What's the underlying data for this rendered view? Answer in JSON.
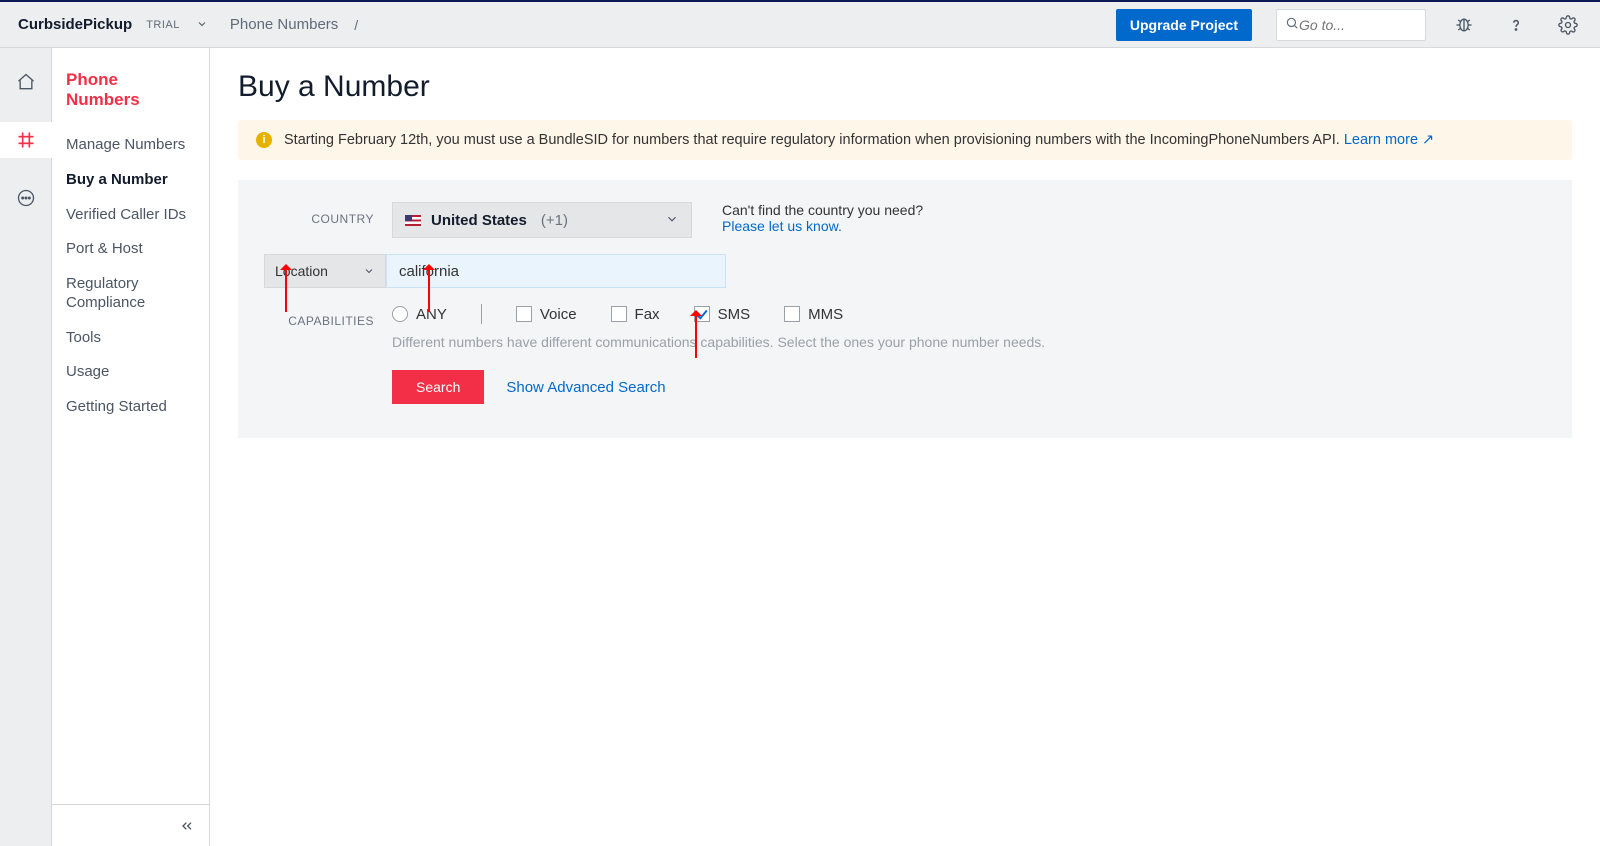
{
  "topbar": {
    "project_name": "CurbsidePickup",
    "trial_label": "TRIAL",
    "breadcrumb": "Phone Numbers",
    "upgrade_label": "Upgrade Project",
    "search_placeholder": "Go to..."
  },
  "sidebar": {
    "title": "Phone Numbers",
    "items": [
      {
        "label": "Manage Numbers",
        "active": false
      },
      {
        "label": "Buy a Number",
        "active": true
      },
      {
        "label": "Verified Caller IDs",
        "active": false
      },
      {
        "label": "Port & Host",
        "active": false
      },
      {
        "label": "Regulatory Compliance",
        "active": false
      },
      {
        "label": "Tools",
        "active": false
      },
      {
        "label": "Usage",
        "active": false
      },
      {
        "label": "Getting Started",
        "active": false
      }
    ]
  },
  "page": {
    "title": "Buy a Number",
    "banner": {
      "text": "Starting February 12th, you must use a BundleSID for numbers that require regulatory information when provisioning numbers with the IncomingPhoneNumbers API.",
      "link_label": "Learn more ↗"
    },
    "form": {
      "country_label": "COUNTRY",
      "country_name": "United States",
      "country_code": "(+1)",
      "country_note_line1": "Can't find the country you need?",
      "country_note_link": "Please let us know.",
      "location_filter_label": "Location",
      "location_value": "california",
      "capabilities_label": "CAPABILITIES",
      "cap_any": "ANY",
      "caps": [
        {
          "key": "voice",
          "label": "Voice",
          "checked": false
        },
        {
          "key": "fax",
          "label": "Fax",
          "checked": false
        },
        {
          "key": "sms",
          "label": "SMS",
          "checked": true
        },
        {
          "key": "mms",
          "label": "MMS",
          "checked": false
        }
      ],
      "cap_hint": "Different numbers have different communications capabilities. Select the ones your phone number needs.",
      "search_label": "Search",
      "advanced_label": "Show Advanced Search"
    }
  }
}
